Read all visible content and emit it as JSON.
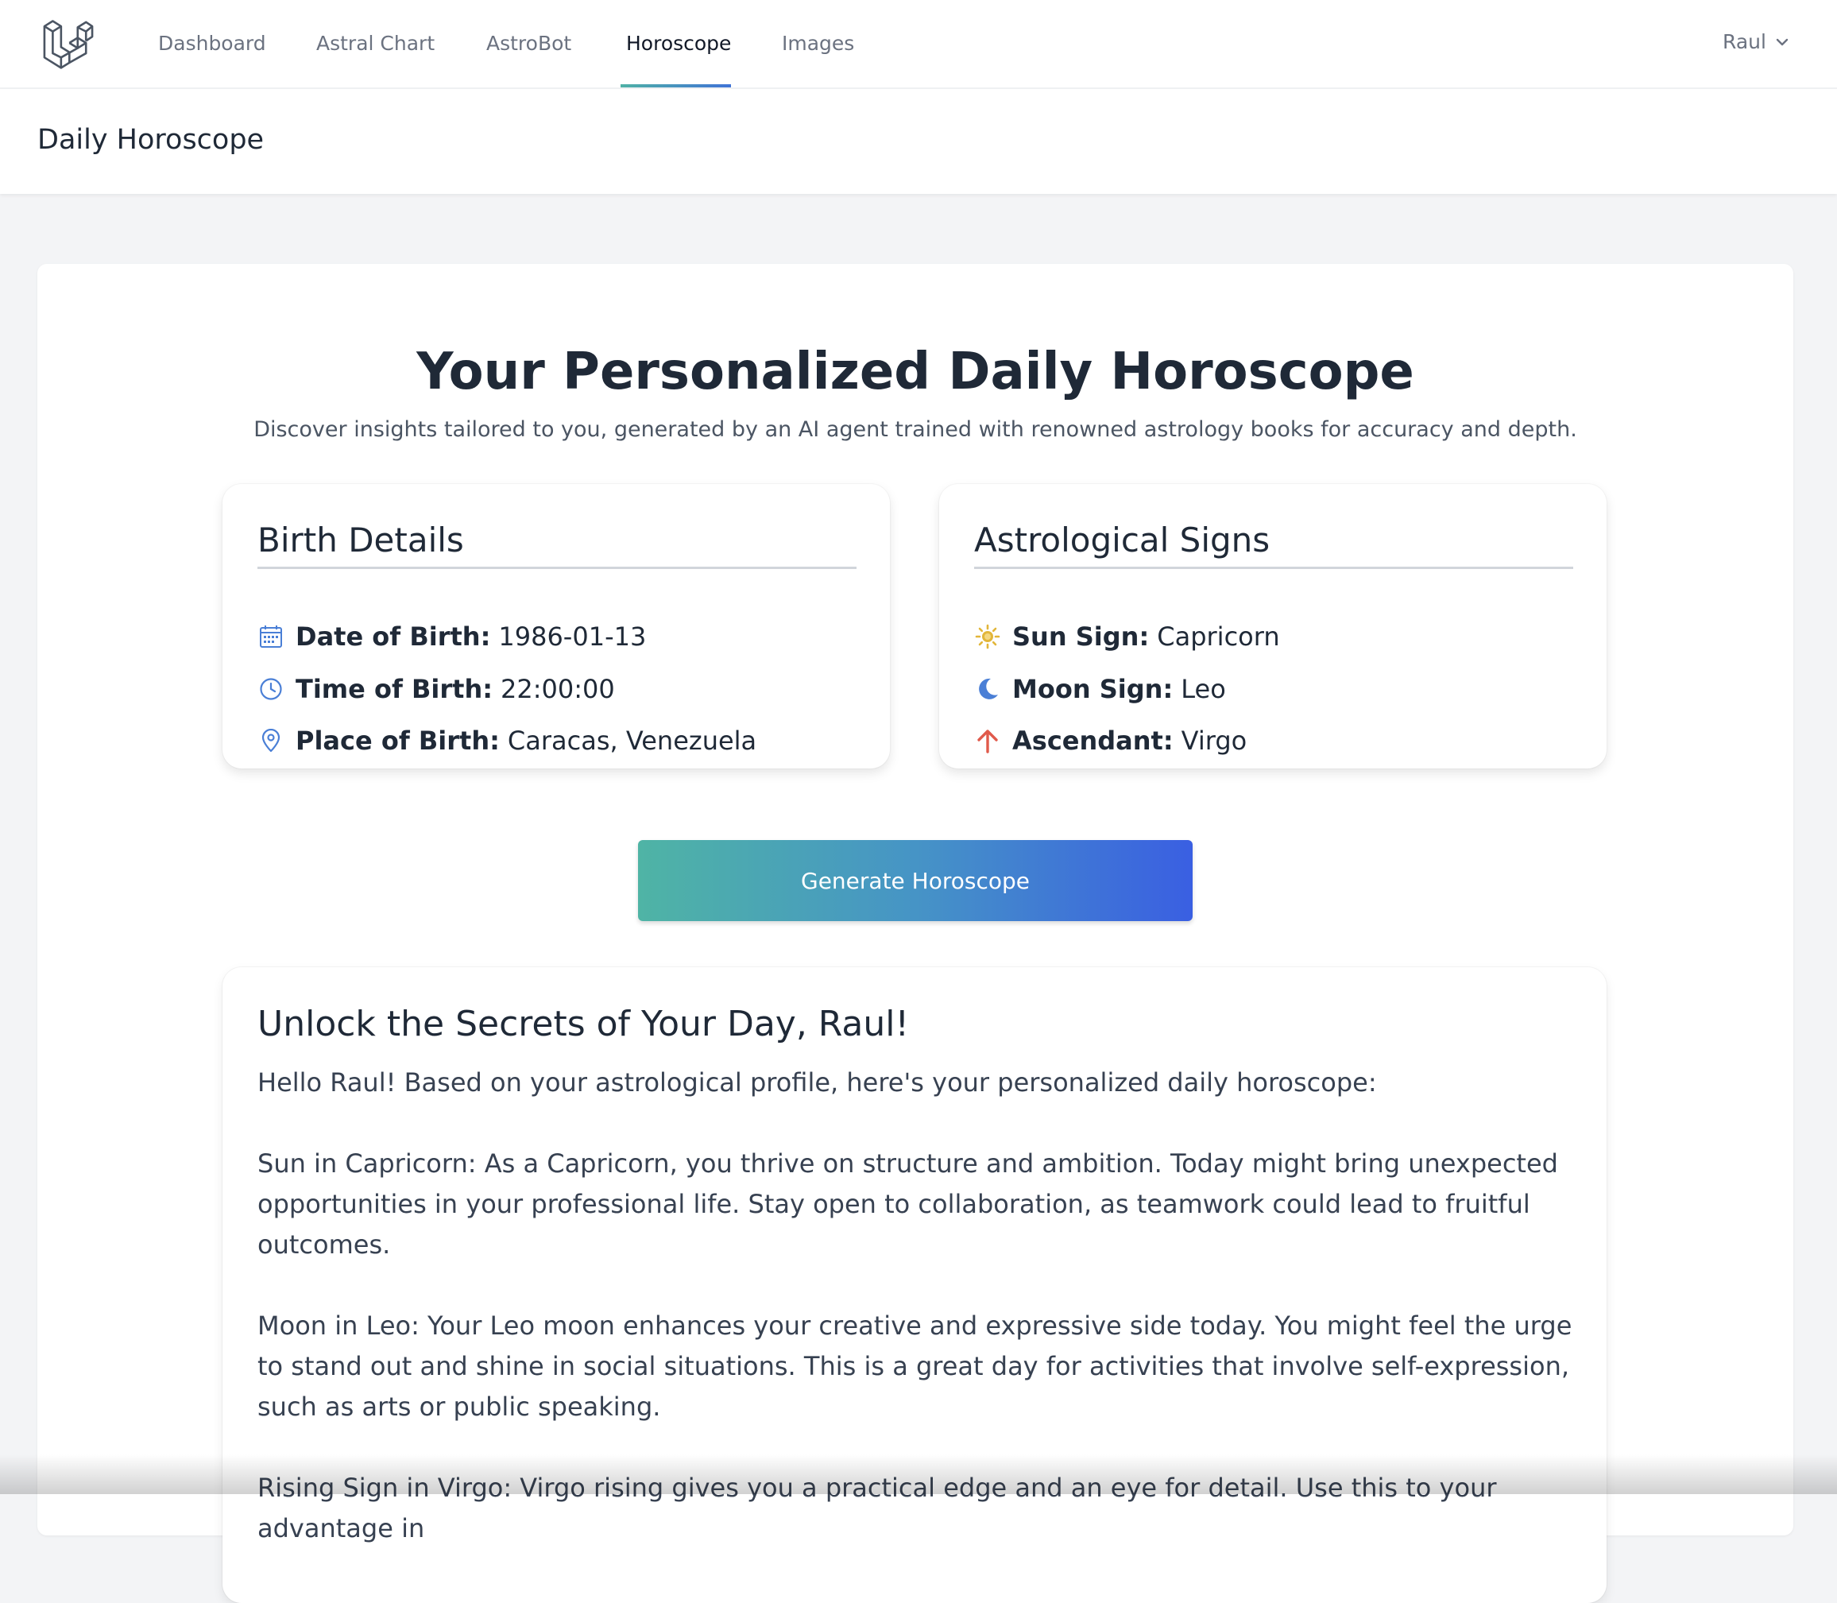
{
  "nav": {
    "logo_icon": "laravel-logo-icon",
    "links": [
      "Dashboard",
      "Astral Chart",
      "AstroBot",
      "Horoscope",
      "Images"
    ],
    "active": "Horoscope",
    "user": "Raul"
  },
  "header": {
    "title": "Daily Horoscope"
  },
  "hero": {
    "title": "Your Personalized Daily Horoscope",
    "subtitle": "Discover insights tailored to you, generated by an AI agent trained with renowned astrology books for accuracy and depth."
  },
  "birth_details": {
    "heading": "Birth Details",
    "date_label": "Date of Birth:",
    "date_value": "1986-01-13",
    "time_label": "Time of Birth:",
    "time_value": "22:00:00",
    "place_label": "Place of Birth:",
    "place_value": "Caracas, Venezuela"
  },
  "signs": {
    "heading": "Astrological Signs",
    "sun_label": "Sun Sign:",
    "sun_value": "Capricorn",
    "moon_label": "Moon Sign:",
    "moon_value": "Leo",
    "asc_label": "Ascendant:",
    "asc_value": "Virgo"
  },
  "button": {
    "generate": "Generate Horoscope"
  },
  "result": {
    "title": "Unlock the Secrets of Your Day, Raul!",
    "paragraphs": [
      "Hello Raul! Based on your astrological profile, here's your personalized daily horoscope:",
      "Sun in Capricorn: As a Capricorn, you thrive on structure and ambition. Today might bring unexpected opportunities in your professional life. Stay open to collaboration, as teamwork could lead to fruitful outcomes.",
      "Moon in Leo: Your Leo moon enhances your creative and expressive side today. You might feel the urge to stand out and shine in social situations. This is a great day for activities that involve self-expression, such as arts or public speaking.",
      "Rising Sign in Virgo: Virgo rising gives you a practical edge and an eye for detail. Use this to your advantage in"
    ]
  },
  "colors": {
    "accent_start": "#4fb4a5",
    "accent_end": "#3a5fe2",
    "icon_blue": "#4a7fd6",
    "sun_yellow": "#e2b63a",
    "ascendant_red": "#e05a4b"
  }
}
